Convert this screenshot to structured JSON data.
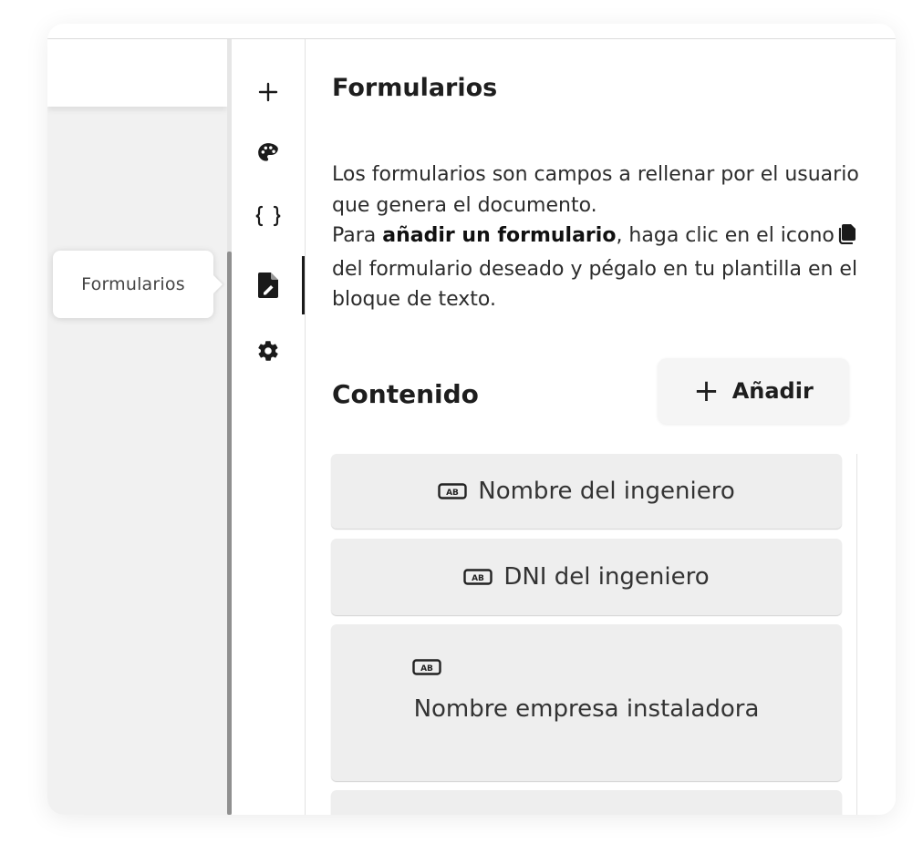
{
  "tooltip": {
    "text": "Formularios"
  },
  "toolbar": {
    "items": [
      {
        "name": "add",
        "icon": "plus-icon"
      },
      {
        "name": "theme",
        "icon": "palette-icon"
      },
      {
        "name": "variables",
        "icon": "braces-icon"
      },
      {
        "name": "forms",
        "icon": "file-signature-icon",
        "active": true
      },
      {
        "name": "settings",
        "icon": "gear-icon"
      }
    ]
  },
  "panel": {
    "title": "Formularios",
    "desc_line1": "Los formularios son campos a rellenar por el usuario que genera el documento.",
    "desc_line2_prefix": "Para ",
    "desc_line2_bold": "añadir un formulario",
    "desc_line2_mid": ", haga clic en el icono",
    "desc_line2_suffix": " del formulario deseado y pégalo en tu plantilla en el bloque de texto.",
    "desc_icon": "copy-icon",
    "section_title": "Contenido",
    "add_button": {
      "plus": "+",
      "label": "Añadir"
    }
  },
  "forms": [
    {
      "label": "Nombre del ingeniero",
      "icon": "text-field-ab-icon"
    },
    {
      "label": "DNI del ingeniero",
      "icon": "text-field-ab-icon"
    },
    {
      "label": "Nombre empresa instaladora",
      "icon": "text-field-ab-icon"
    }
  ],
  "colors": {
    "background": "#ffffff",
    "canvas": "#f1f1f1",
    "item_background": "#eeeeee",
    "text": "#1e1e1e",
    "active_indicator": "#1a1a1a"
  }
}
